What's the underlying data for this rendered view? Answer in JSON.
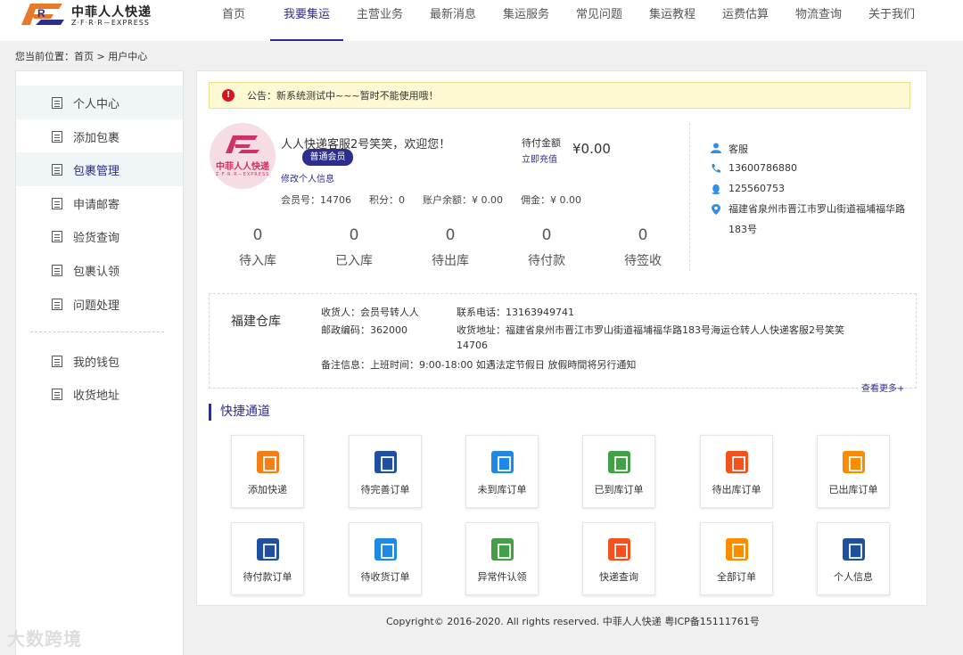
{
  "brand": {
    "name_cn": "中菲人人快递",
    "name_en": "Z·F·R·R－EXPRESS",
    "color": "#2d2d8c",
    "accent": "#e8782a"
  },
  "nav": [
    {
      "label": "首页",
      "active": false
    },
    {
      "label": "我要集运",
      "active": true
    },
    {
      "label": "主营业务",
      "active": false
    },
    {
      "label": "最新消息",
      "active": false
    },
    {
      "label": "集运服务",
      "active": false
    },
    {
      "label": "常见问题",
      "active": false
    },
    {
      "label": "集运教程",
      "active": false
    },
    {
      "label": "运费估算",
      "active": false
    },
    {
      "label": "物流查询",
      "active": false
    },
    {
      "label": "关于我们",
      "active": false
    }
  ],
  "breadcrumb": {
    "prefix": "您当前位置：",
    "home": "首页",
    "sep": " > ",
    "current": "用户中心"
  },
  "sidebar": {
    "items": [
      {
        "label": "个人中心",
        "icon": "doc-icon"
      },
      {
        "label": "添加包裹",
        "icon": "doc-icon"
      },
      {
        "label": "包裹管理",
        "icon": "doc-icon"
      },
      {
        "label": "申请邮寄",
        "icon": "doc-icon"
      },
      {
        "label": "验货查询",
        "icon": "doc-icon"
      },
      {
        "label": "包裹认领",
        "icon": "doc-icon"
      },
      {
        "label": "问题处理",
        "icon": "doc-icon"
      },
      {
        "label": "我的钱包",
        "icon": "doc-icon"
      },
      {
        "label": "收货地址",
        "icon": "doc-icon"
      }
    ]
  },
  "notice": {
    "text": "公告：新系统测试中~~~暂时不能使用哦！",
    "icon_text": "!",
    "icon": "alert-icon"
  },
  "user": {
    "avatar_cn": "中菲人人快递",
    "avatar_en": "Z·F·R·R－EXPRESS",
    "welcome": "人人快递客服2号笑笑，欢迎您！",
    "member_level": "普通会员",
    "edit_link": "修改个人信息",
    "pay_label": "待付金额",
    "pay_link": "立即充值",
    "pay_amount": "¥0.00",
    "stats": [
      "会员号：14706",
      "积分：0",
      "账户余额：¥ 0.00",
      "佣金：¥ 0.00"
    ]
  },
  "counters": [
    {
      "value": "0",
      "label": "待入库"
    },
    {
      "value": "0",
      "label": "已入库"
    },
    {
      "value": "0",
      "label": "待出库"
    },
    {
      "value": "0",
      "label": "待付款"
    },
    {
      "value": "0",
      "label": "待签收"
    }
  ],
  "contact": {
    "service": "客服",
    "phone": "13600786880",
    "qq": "125560753",
    "address": "福建省泉州市晋江市罗山街道福埔福华路183号"
  },
  "warehouse": {
    "name": "福建仓库",
    "receiver": "收货人：会员号转人人",
    "tel": "联系电话：13163949741",
    "postcode": "邮政编码：362000",
    "address": "收货地址：福建省泉州市晋江市罗山街道福埔福华路183号海运仓转人人快递客服2号笑笑",
    "address_cont": "14706",
    "remark": "备注信息：上班时间：9:00-18:00 如遇法定节假日 放假時間将另行通知",
    "more": "查看更多+"
  },
  "quick": {
    "title": "快捷通道",
    "tiles": [
      {
        "label": "添加快递",
        "color": "#f57f17",
        "icon": "add-express-icon"
      },
      {
        "label": "待完善订单",
        "color": "#1e4fa0",
        "icon": "pending-order-icon"
      },
      {
        "label": "未到库订单",
        "color": "#1e88e5",
        "icon": "not-arrived-icon"
      },
      {
        "label": "已到库订单",
        "color": "#43a047",
        "icon": "arrived-icon"
      },
      {
        "label": "待出库订单",
        "color": "#f4511e",
        "icon": "awaiting-shipment-icon"
      },
      {
        "label": "已出库订单",
        "color": "#fb8c00",
        "icon": "shipped-icon"
      },
      {
        "label": "待付款订单",
        "color": "#1e4fa0",
        "icon": "payment-pending-icon"
      },
      {
        "label": "待收货订单",
        "color": "#1e88e5",
        "icon": "to-receive-icon"
      },
      {
        "label": "异常件认领",
        "color": "#43a047",
        "icon": "exception-claim-icon"
      },
      {
        "label": "快递查询",
        "color": "#f4511e",
        "icon": "search-icon"
      },
      {
        "label": "全部订单",
        "color": "#fb8c00",
        "icon": "all-orders-icon"
      },
      {
        "label": "个人信息",
        "color": "#1e4fa0",
        "icon": "profile-icon"
      }
    ]
  },
  "footer": {
    "text": "Copyright© 2016-2020. All rights reserved. 中菲人人快递 粤ICP备15111761号"
  },
  "watermark": {
    "text": "大数跨境"
  }
}
